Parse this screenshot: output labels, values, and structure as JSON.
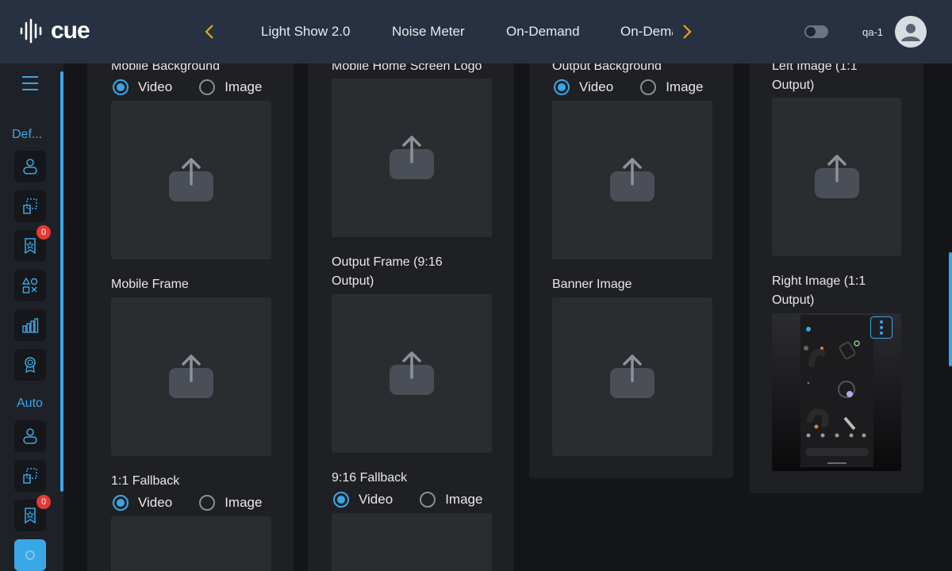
{
  "app": {
    "logo_text": "cue"
  },
  "nav": {
    "tabs": [
      {
        "label": "Light Show 2.0"
      },
      {
        "label": "Noise Meter"
      },
      {
        "label": "On-Demand"
      },
      {
        "label": "On-Demand"
      }
    ]
  },
  "user": {
    "name": "qa-1"
  },
  "sidebar": {
    "section1": "Def...",
    "section2": "Auto",
    "badge_count_1": "0",
    "badge_count_2": "0"
  },
  "fields": {
    "mobile_background": "Mobile Background",
    "mobile_frame": "Mobile Frame",
    "fallback_1_1": "1:1 Fallback",
    "mobile_home_logo": "Mobile Home Screen Logo",
    "output_frame": "Output Frame (9:16 Output)",
    "fallback_9_16": "9:16 Fallback",
    "output_background": "Output Background",
    "banner_image": "Banner Image",
    "left_image": "Left Image (1:1 Output)",
    "right_image": "Right Image (1:1 Output)"
  },
  "radio": {
    "video": "Video",
    "image": "Image"
  },
  "colors": {
    "accent": "#3aa7e6",
    "warning": "#e6a817",
    "badge": "#e53935"
  }
}
